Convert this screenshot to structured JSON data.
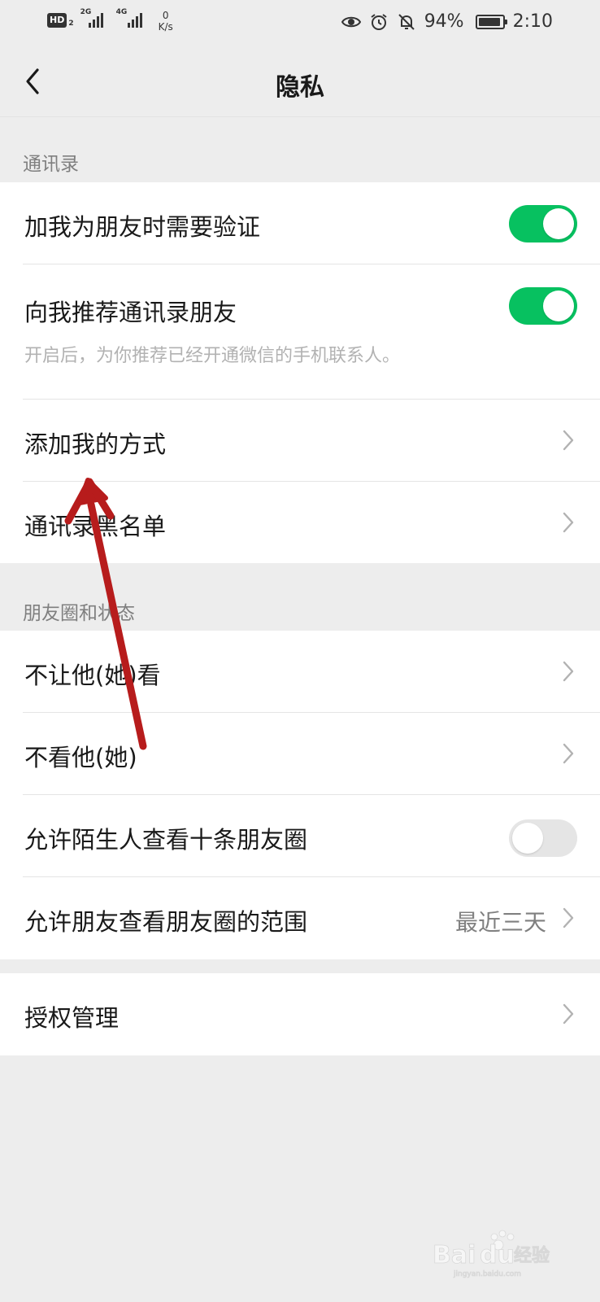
{
  "status_bar": {
    "hd": "HD",
    "hd_sub": "2",
    "net1": "2G",
    "net2": "4G",
    "speed_value": "0",
    "speed_unit": "K/s",
    "battery_percent": "94%",
    "battery_level": 0.94,
    "time": "2:10"
  },
  "nav": {
    "title": "隐私"
  },
  "sections": {
    "contacts_header": "通讯录",
    "moments_header": "朋友圈和状态"
  },
  "contacts": {
    "verify": {
      "label": "加我为朋友时需要验证",
      "on": true
    },
    "recommend": {
      "label": "向我推荐通讯录朋友",
      "on": true,
      "desc": "开启后，为你推荐已经开通微信的手机联系人。"
    },
    "add_methods": {
      "label": "添加我的方式"
    },
    "blacklist": {
      "label": "通讯录黑名单"
    }
  },
  "moments": {
    "hide_from": {
      "label": "不让他(她)看"
    },
    "not_see": {
      "label": "不看他(她)"
    },
    "stranger_ten": {
      "label": "允许陌生人查看十条朋友圈",
      "on": false
    },
    "visible_range": {
      "label": "允许朋友查看朋友圈的范围",
      "value": "最近三天"
    }
  },
  "authorization": {
    "label": "授权管理"
  },
  "watermark": {
    "brand": "Bai",
    "brand2": "du",
    "cn": "经验",
    "url": "jingyan.baidu.com"
  },
  "colors": {
    "accent_green": "#07c160",
    "background": "#ededed",
    "annotation_arrow": "#b71c1c"
  }
}
